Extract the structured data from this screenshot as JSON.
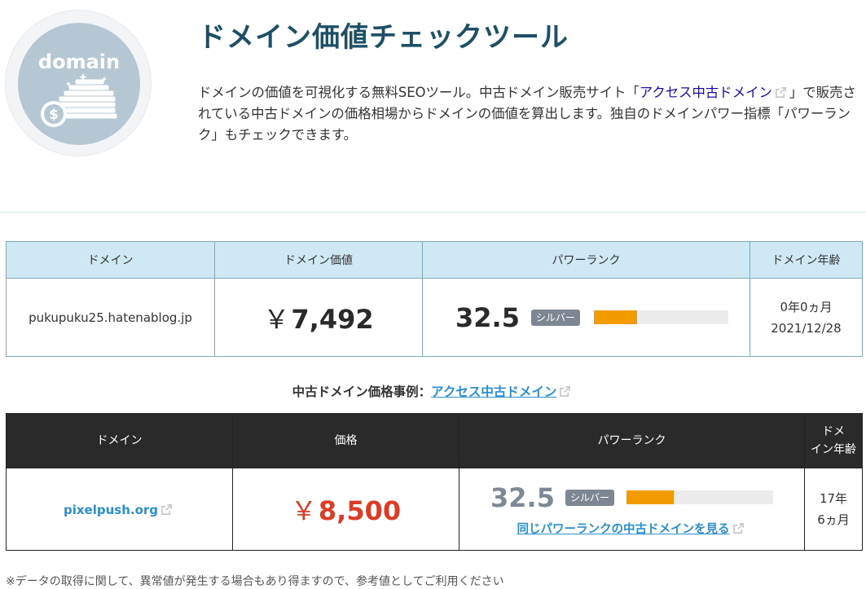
{
  "logo": {
    "text": "domain"
  },
  "header": {
    "title": "ドメイン価値チェックツール",
    "intro_part1": "ドメインの価値を可視化する無料SEOツール。中古ドメイン販売サイト「",
    "intro_link": "アクセス中古ドメイン",
    "intro_part2": "」で販売されている中古ドメインの価格相場からドメインの価値を算出します。独自のドメインパワー指標「パワーランク」もチェックできます。"
  },
  "result_table": {
    "headers": [
      "ドメイン",
      "ドメイン価値",
      "パワーランク",
      "ドメイン年齢"
    ],
    "domain": "pukupuku25.hatenablog.jp",
    "value_yen": "￥",
    "value": "7,492",
    "power_rank": "32.5",
    "rank_badge": "シルバー",
    "rank_fill": 0.32,
    "age": "0年0ヵ月",
    "date": "2021/12/28"
  },
  "example": {
    "caption": "中古ドメイン価格事例：",
    "caption_link": "アクセス中古ドメイン",
    "headers": [
      "ドメイン",
      "価格",
      "パワーランク",
      "ドメ\nイン年齢"
    ],
    "header_age_line1": "ドメ",
    "header_age_line2": "イン年齢",
    "domain": "pixelpush.org",
    "price_yen": "￥",
    "price": "8,500",
    "power_rank": "32.5",
    "rank_badge": "シルバー",
    "rank_fill": 0.32,
    "same_rank_link": "同じパワーランクの中古ドメインを見る",
    "age_line1": "17年",
    "age_line2": "6ヵ月"
  },
  "footnote": "※データの取得に関して、異常値が発生する場合もあり得ますので、参考値としてご利用ください",
  "colors": {
    "title": "#1d4f66",
    "header_bg": "#cfe9f4",
    "dark_header_bg": "#2a2a2a",
    "accent_orange": "#f29b00",
    "price_red": "#dc3b26",
    "link_blue": "#2b8fcf"
  }
}
